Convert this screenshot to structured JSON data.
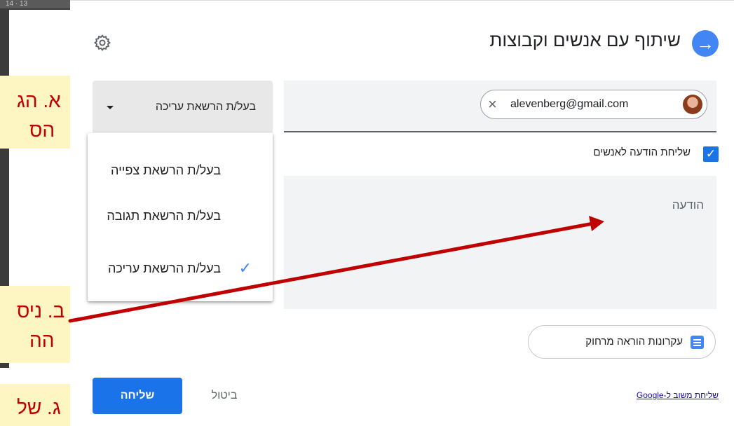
{
  "background": {
    "ruler_text": "14 · 13"
  },
  "callouts": [
    {
      "text": "א. הג",
      "text2": "הס"
    },
    {
      "text": "ב. ניס",
      "text2": "הה"
    },
    {
      "text": "ג. של"
    }
  ],
  "dialog": {
    "title": "שיתוף עם אנשים וקבוצות",
    "back_icon": "arrow-right-icon",
    "settings_icon": "gear-icon",
    "permission_select": {
      "selected": "בעל/ת הרשאת עריכה"
    },
    "recipient": {
      "email": "alevenberg@gmail.com",
      "remove_glyph": "×"
    },
    "notify": {
      "label": "שליחת הודעה לאנשים",
      "checked": true,
      "check_glyph": "✓"
    },
    "message": {
      "placeholder": "הודעה"
    },
    "classroom": {
      "label": "עקרונות הוראה מרחוק"
    },
    "buttons": {
      "send": "שליחה",
      "cancel": "ביטול"
    },
    "feedback_link": "שליחת משוב ל-Google"
  },
  "dropdown": {
    "items": [
      {
        "label": "בעל/ת הרשאת צפייה",
        "selected": false
      },
      {
        "label": "בעל/ת הרשאת תגובה",
        "selected": false
      },
      {
        "label": "בעל/ת הרשאת עריכה",
        "selected": true
      }
    ],
    "check_glyph": "✓"
  },
  "colors": {
    "accent": "#1a73e8",
    "arrow": "#c00000",
    "callout_bg": "#fdf6c3"
  }
}
